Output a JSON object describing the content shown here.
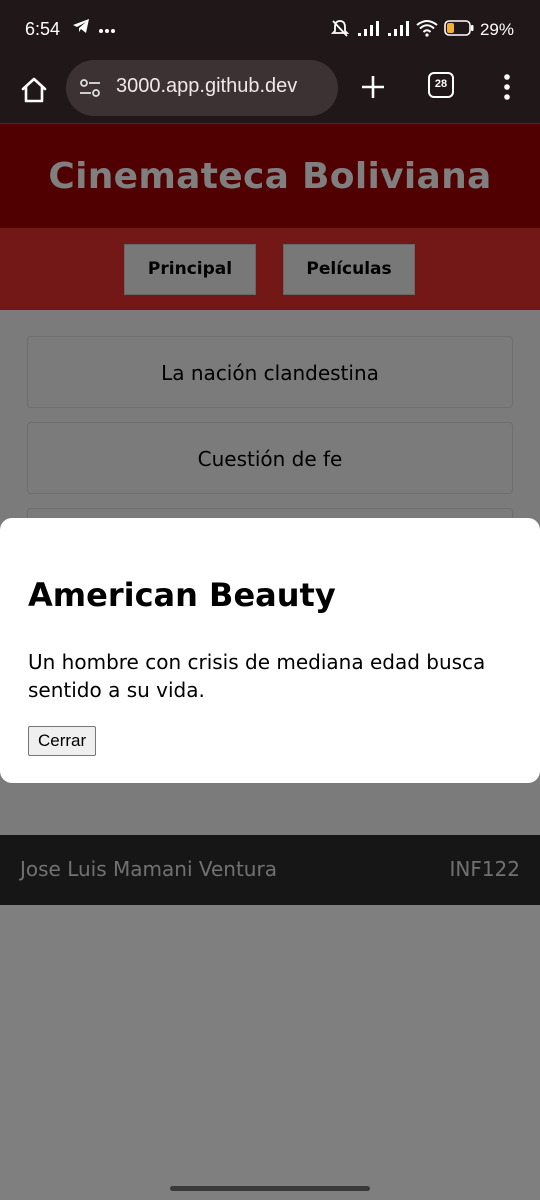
{
  "status_bar": {
    "time": "6:54",
    "battery": "29%",
    "icons": [
      "telegram-icon",
      "more-notifications-icon",
      "mute-icon",
      "signal-icon",
      "signal-icon",
      "wifi-icon",
      "battery-icon"
    ]
  },
  "browser": {
    "url": "3000.app.github.dev",
    "tab_count": "28"
  },
  "site": {
    "title": "Cinemateca Boliviana",
    "nav": [
      "Principal",
      "Películas"
    ],
    "movies": [
      "La nación clandestina",
      "Cuestión de fe"
    ],
    "footer": {
      "author": "Jose Luis Mamani Ventura",
      "course": "INF122"
    }
  },
  "modal": {
    "title": "American Beauty",
    "description": "Un hombre con crisis de mediana edad busca sentido a su vida.",
    "close_label": "Cerrar"
  },
  "colors": {
    "header_bg": "#a00000",
    "nav_bg": "#e82e2e",
    "footer_bg": "#2c2c2c",
    "browser_bg": "#201718"
  }
}
